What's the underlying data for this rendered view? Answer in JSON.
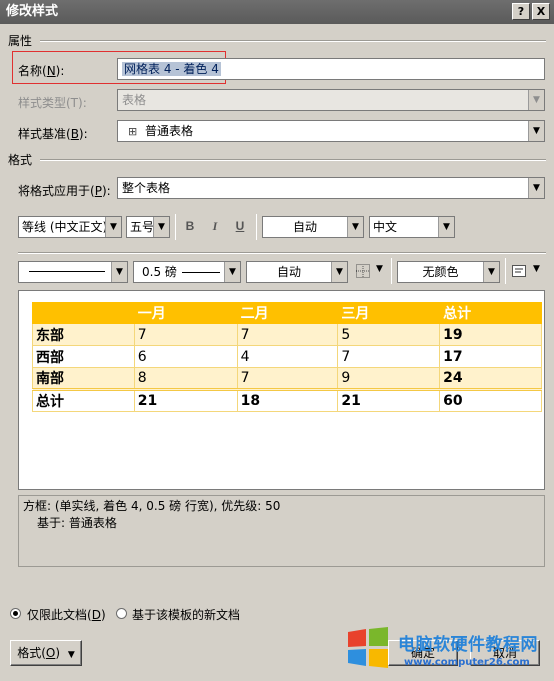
{
  "dialog": {
    "title": "修改样式",
    "help_glyph": "?",
    "close_glyph": "X"
  },
  "properties": {
    "section_label": "属性",
    "name_label": "名称(",
    "name_key": "N",
    "name_label_end": "):",
    "name_value": "网格表 4 - 着色 4",
    "style_type_label": "样式类型(T):",
    "style_type_value": "表格",
    "based_on_label": "样式基准(",
    "based_on_key": "B",
    "based_on_label_end": "):",
    "based_on_value": "普通表格"
  },
  "format": {
    "section_label": "格式",
    "apply_to_label": "将格式应用于(",
    "apply_to_key": "P",
    "apply_to_label_end": "):",
    "apply_to_value": "整个表格",
    "font_value": "等线 (中文正文)",
    "size_value": "五号",
    "bold": "B",
    "italic": "I",
    "underline": "U",
    "font_color_value": "自动",
    "language_value": "中文",
    "border_weight_value": "0.5 磅",
    "border_color_value": "自动",
    "shading_value": "无颜色"
  },
  "preview": {
    "headers": [
      "",
      "一月",
      "二月",
      "三月",
      "总计"
    ],
    "rows": [
      [
        "东部",
        "7",
        "7",
        "5",
        "19"
      ],
      [
        "西部",
        "6",
        "4",
        "7",
        "17"
      ],
      [
        "南部",
        "8",
        "7",
        "9",
        "24"
      ],
      [
        "总计",
        "21",
        "18",
        "21",
        "60"
      ]
    ],
    "header_color": "#ffc000",
    "band_color": "#fff2cc"
  },
  "description": {
    "line1": "方框: (单实线, 着色 4,  0.5 磅 行宽), 优先级: 50",
    "line2": "基于: 普通表格"
  },
  "options": {
    "only_this_doc_label": "仅限此文档(",
    "only_this_doc_key": "D",
    "only_this_doc_end": ")",
    "new_docs_label": "基于该模板的新文档"
  },
  "buttons": {
    "format_label": "格式(",
    "format_key": "O",
    "format_end": ")",
    "ok_label": "确定",
    "cancel_label": "取消"
  },
  "watermark": {
    "text": "电脑软硬件教程网",
    "url": "www.computer26.com"
  }
}
